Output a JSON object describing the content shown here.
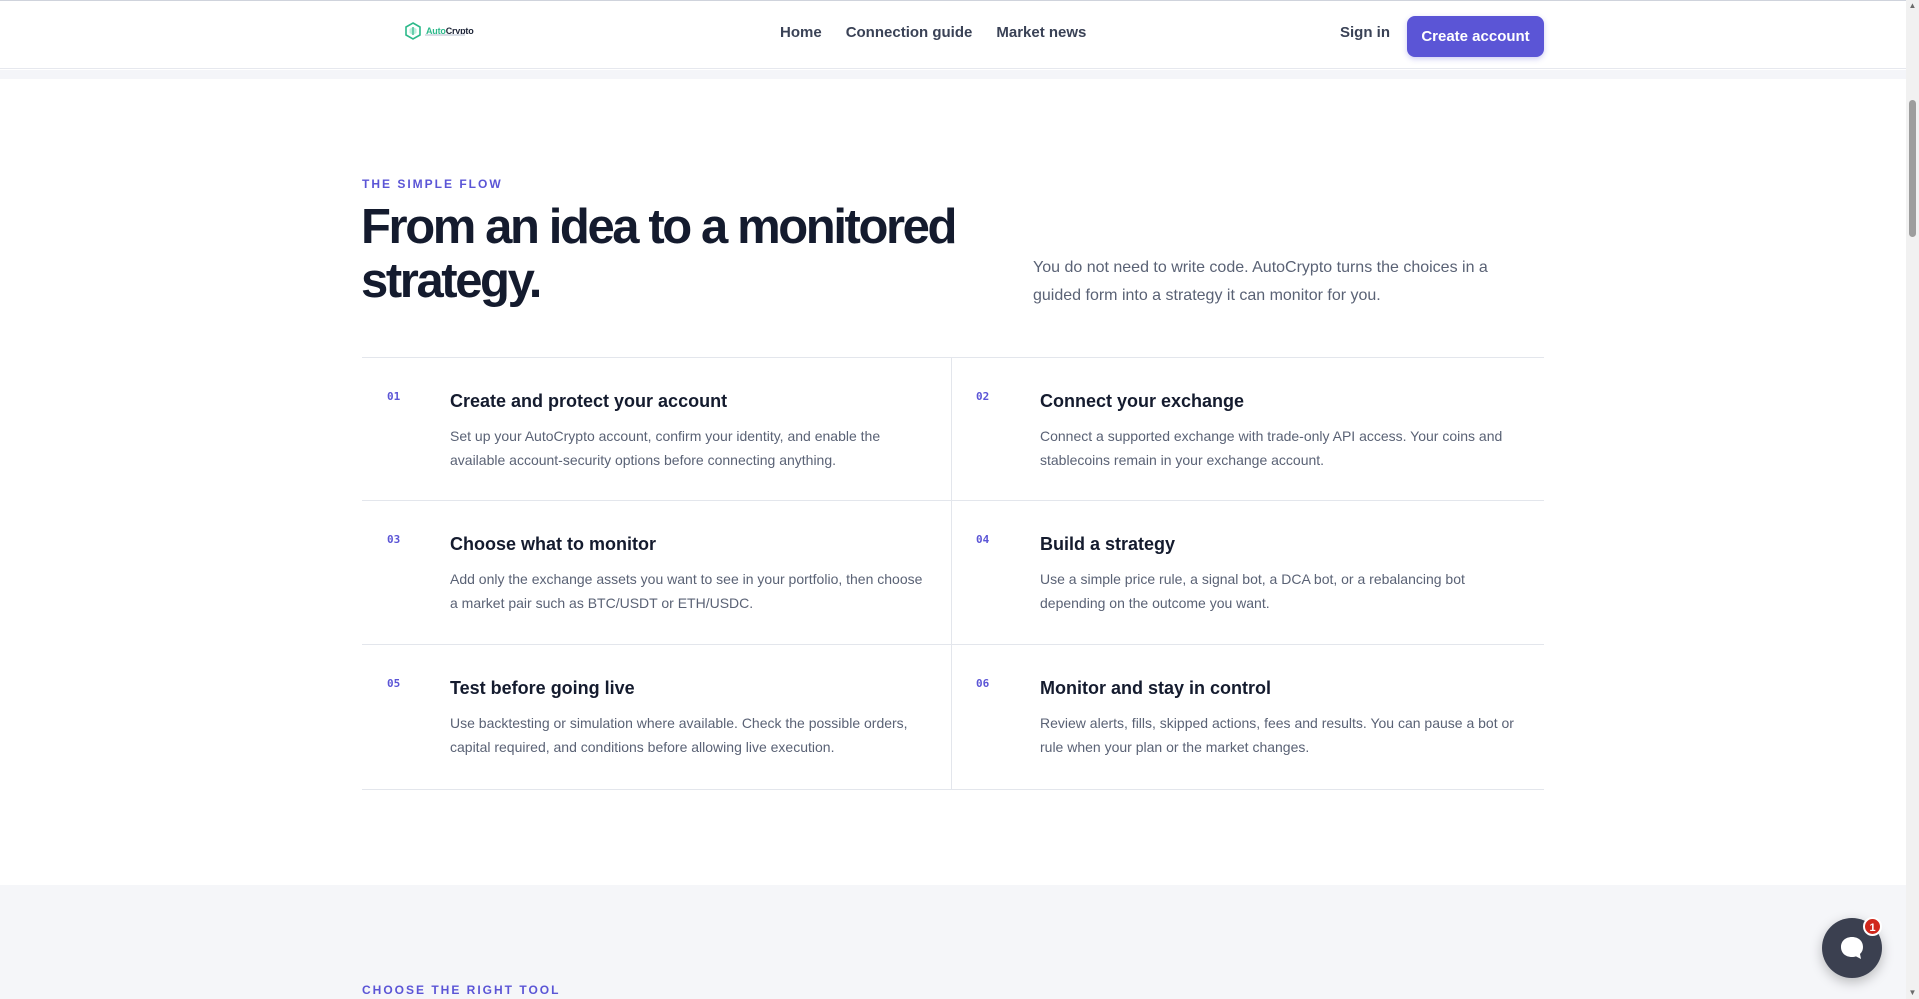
{
  "header": {
    "logo": {
      "part1": "Auto",
      "part2": "Crypto"
    },
    "nav": [
      {
        "label": "Home"
      },
      {
        "label": "Connection guide"
      },
      {
        "label": "Market news"
      }
    ],
    "sign_in": "Sign in",
    "create_account": "Create account"
  },
  "hero": {
    "eyebrow": "THE SIMPLE FLOW",
    "title_line1": "From an idea to a monitored",
    "title_line2": "strategy.",
    "intro": "You do not need to write code. AutoCrypto turns the choices in a guided form into a strategy it can monitor for you."
  },
  "steps": [
    {
      "num": "01",
      "title": "Create and protect your account",
      "desc": "Set up your AutoCrypto account, confirm your identity, and enable the available account-security options before connecting anything."
    },
    {
      "num": "02",
      "title": "Connect your exchange",
      "desc": "Connect a supported exchange with trade-only API access. Your coins and stablecoins remain in your exchange account."
    },
    {
      "num": "03",
      "title": "Choose what to monitor",
      "desc": "Add only the exchange assets you want to see in your portfolio, then choose a market pair such as BTC/USDT or ETH/USDC."
    },
    {
      "num": "04",
      "title": "Build a strategy",
      "desc": "Use a simple price rule, a signal bot, a DCA bot, or a rebalancing bot depending on the outcome you want."
    },
    {
      "num": "05",
      "title": "Test before going live",
      "desc": "Use backtesting or simulation where available. Check the possible orders, capital required, and conditions before allowing live execution."
    },
    {
      "num": "06",
      "title": "Monitor and stay in control",
      "desc": "Review alerts, fills, skipped actions, fees and results. You can pause a bot or rule when your plan or the market changes."
    }
  ],
  "next_section": {
    "eyebrow": "CHOOSE THE RIGHT TOOL"
  },
  "chat": {
    "badge_count": "1",
    "icon": "chat-bubble-icon"
  },
  "colors": {
    "accent": "#5b55d6",
    "brand_green": "#2cb98a",
    "text_dark": "#141b2e",
    "text_muted": "#5a6275"
  }
}
